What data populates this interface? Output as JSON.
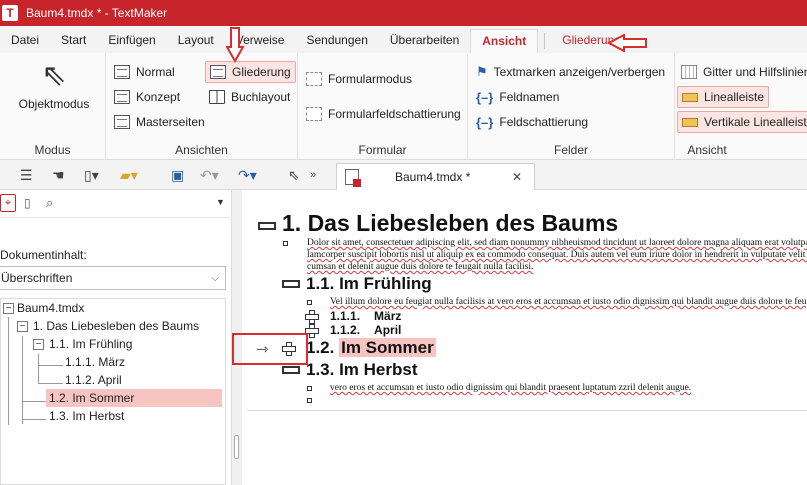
{
  "window": {
    "title": "Baum4.tmdx * - TextMaker",
    "logo": "T"
  },
  "menu": {
    "tabs": [
      "Datei",
      "Start",
      "Einfügen",
      "Layout",
      "Verweise",
      "Sendungen",
      "Überarbeiten",
      "Ansicht"
    ],
    "active": "Ansicht",
    "context_tab": "Gliederung"
  },
  "ribbon": {
    "modus": {
      "button": "Objektmodus",
      "group": "Modus"
    },
    "ansichten": {
      "group": "Ansichten",
      "items": [
        "Normal",
        "Konzept",
        "Masterseiten",
        "Gliederung",
        "Buchlayout"
      ],
      "selected": "Gliederung"
    },
    "formular": {
      "group": "Formular",
      "items": [
        "Formularmodus",
        "Formularfeldschattierung"
      ]
    },
    "felder": {
      "group": "Felder",
      "items": [
        "Textmarken anzeigen/verbergen",
        "Feldnamen",
        "Feldschattierung"
      ]
    },
    "ansicht": {
      "group": "Ansicht",
      "items": [
        "Gitter und Hilfslinien",
        "Linealleiste",
        "Vertikale Linealleiste"
      ]
    }
  },
  "doc_tab": {
    "name": "Baum4.tmdx *",
    "close": "✕"
  },
  "sidebar": {
    "label": "Dokumentinhalt:",
    "dropdown": "Überschriften",
    "tree": [
      {
        "label": "Baum4.tmdx",
        "level": 0,
        "exp": "−"
      },
      {
        "label": "1. Das Liebesleben des Baums",
        "level": 1,
        "exp": "−"
      },
      {
        "label": "1.1. Im Frühling",
        "level": 2,
        "exp": "−"
      },
      {
        "label": "1.1.1. März",
        "level": 3,
        "exp": ""
      },
      {
        "label": "1.1.2. April",
        "level": 3,
        "exp": ""
      },
      {
        "label": "1.2. Im Sommer",
        "level": 2,
        "exp": "",
        "selected": true
      },
      {
        "label": "1.3. Im Herbst",
        "level": 2,
        "exp": ""
      }
    ]
  },
  "document": {
    "h1": "1. Das Liebesleben des Baums",
    "p1_line1": "Dolor sit amet, consectetuer adipiscing elit, sed diam nonummy nibheuismod tincidunt ut laoreet dolore magna aliquam erat volutpat. Ut wisi enim ad minim veniam, quis nostrud exerci",
    "p1_line2": "lamcorper suscipit lobortis nisl ut aliquip ex ea commodo consequat. Duis autem vel eum iriure dolor in hendrerit in vulputate velit esse molestie consequat, vel illum dolore eu feugiat nulla",
    "p1_line3": "cumsan et delenit augue duis dolore te feugait nulla facilisi.",
    "h2_1": "1.1. Im Frühling",
    "p2": "Vel illum dolore eu feugiat nulla facilisis at vero eros et accumsan et iusto odio dignissim qui blandit augue duis dolore te feugait nulla facilisi.",
    "h3_1_num": "1.1.1.",
    "h3_1_text": "März",
    "h3_2_num": "1.1.2.",
    "h3_2_text": "April",
    "h2_2_num": "1.2.",
    "h2_2_text": "Im Sommer",
    "h2_3": "1.3. Im Herbst",
    "p3": "vero eros et accumsan et iusto odio dignissim qui blandit praesent luptatum zzril delenit augue."
  },
  "colors": {
    "brand": "#c8242b",
    "selection": "#f7c5c1",
    "annotation": "#d62d2d"
  }
}
